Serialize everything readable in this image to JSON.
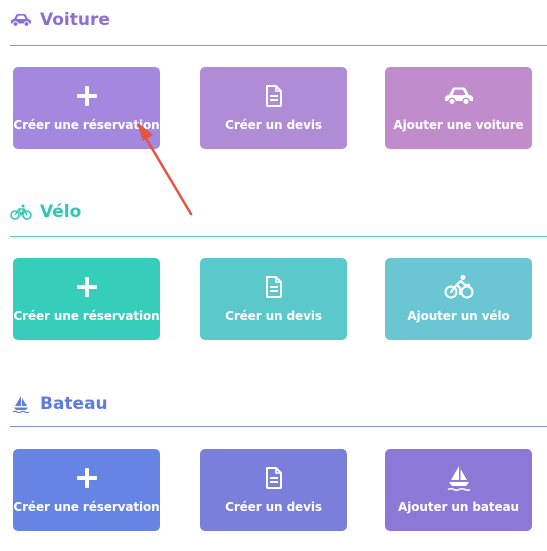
{
  "colors": {
    "voiture_accent": "#8b6fd6",
    "velo_accent": "#2fc7b4",
    "bateau_accent": "#5f7be0",
    "annotation_arrow": "#e8523f"
  },
  "sections": {
    "voiture": {
      "title": "Voiture",
      "icon": "car-icon",
      "cards": [
        {
          "label": "Créer une réservation",
          "icon": "plus-icon"
        },
        {
          "label": "Créer un devis",
          "icon": "document-icon"
        },
        {
          "label": "Ajouter une voiture",
          "icon": "car-icon"
        }
      ]
    },
    "velo": {
      "title": "Vélo",
      "icon": "bicycle-icon",
      "cards": [
        {
          "label": "Créer une réservation",
          "icon": "plus-icon"
        },
        {
          "label": "Créer un devis",
          "icon": "document-icon"
        },
        {
          "label": "Ajouter un vélo",
          "icon": "cyclist-icon"
        }
      ]
    },
    "bateau": {
      "title": "Bateau",
      "icon": "sailboat-icon",
      "cards": [
        {
          "label": "Créer une réservation",
          "icon": "plus-icon"
        },
        {
          "label": "Créer un devis",
          "icon": "document-icon"
        },
        {
          "label": "Ajouter un bateau",
          "icon": "sailboat-icon"
        }
      ]
    }
  }
}
